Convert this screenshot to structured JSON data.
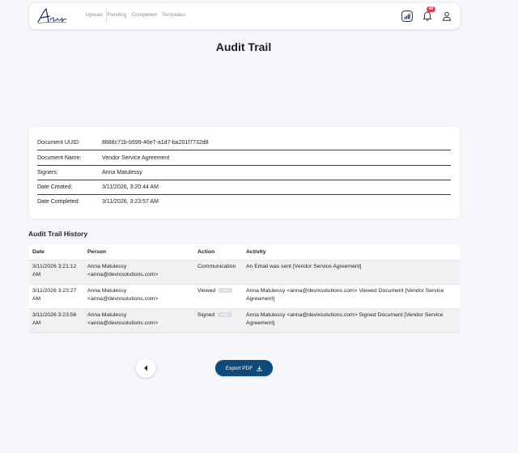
{
  "header": {
    "logo_text": "Assignu",
    "nav": [
      "Upload",
      "Pending",
      "Completed",
      "Templates"
    ],
    "notification_count": "40",
    "icons": [
      "signal-icon",
      "bell-icon",
      "user-icon"
    ]
  },
  "page": {
    "title": "Audit Trail"
  },
  "details": {
    "uuid_label": "Document UUID:",
    "uuid_value": "8888c71b-b599-46e7-a1d7-ba201f7732d8",
    "name_label": "Document Name:",
    "name_value": "Vendor Service Agreement",
    "signers_label": "Signers:",
    "signers_value": "Anna Matulessy",
    "created_label": "Date Created:",
    "created_value": "3/11/2026, 3:20:44 AM",
    "completed_label": "Date Completed:",
    "completed_value": "3/11/2026, 3:23:57 AM"
  },
  "history": {
    "heading": "Audit Trail History",
    "columns": [
      "Date",
      "Person",
      "Action",
      "Activity"
    ],
    "rows": [
      {
        "date": "3/11/2026 3:21:12 AM",
        "person": "Anna Matulessy <anna@devixsolutions.com>",
        "action": "Communication",
        "tag": "",
        "activity": "An Email was sent [Vendor Service Agreement]"
      },
      {
        "date": "3/11/2026 3:23:27 AM",
        "person": "Anna Matulessy <anna@devixsolutions.com>",
        "action": "Viewed",
        "tag": "Login",
        "activity": "Anna Matulessy <anna@devixsolutions.com> Viewed Document [Vendor Service Agreement]"
      },
      {
        "date": "3/11/2026 3:23:56 AM",
        "person": "Anna Matulessy <anna@devixsolutions.com>",
        "action": "Signed",
        "tag": "Login",
        "activity": "Anna Matulessy <anna@devixsolutions.com> Signed Document [Vendor Service Agreement]"
      }
    ]
  },
  "actions": {
    "export_label": "Export PDF"
  },
  "colors": {
    "accent": "#0e4a77",
    "badge": "#e5384f",
    "background": "#f6f7fb"
  }
}
